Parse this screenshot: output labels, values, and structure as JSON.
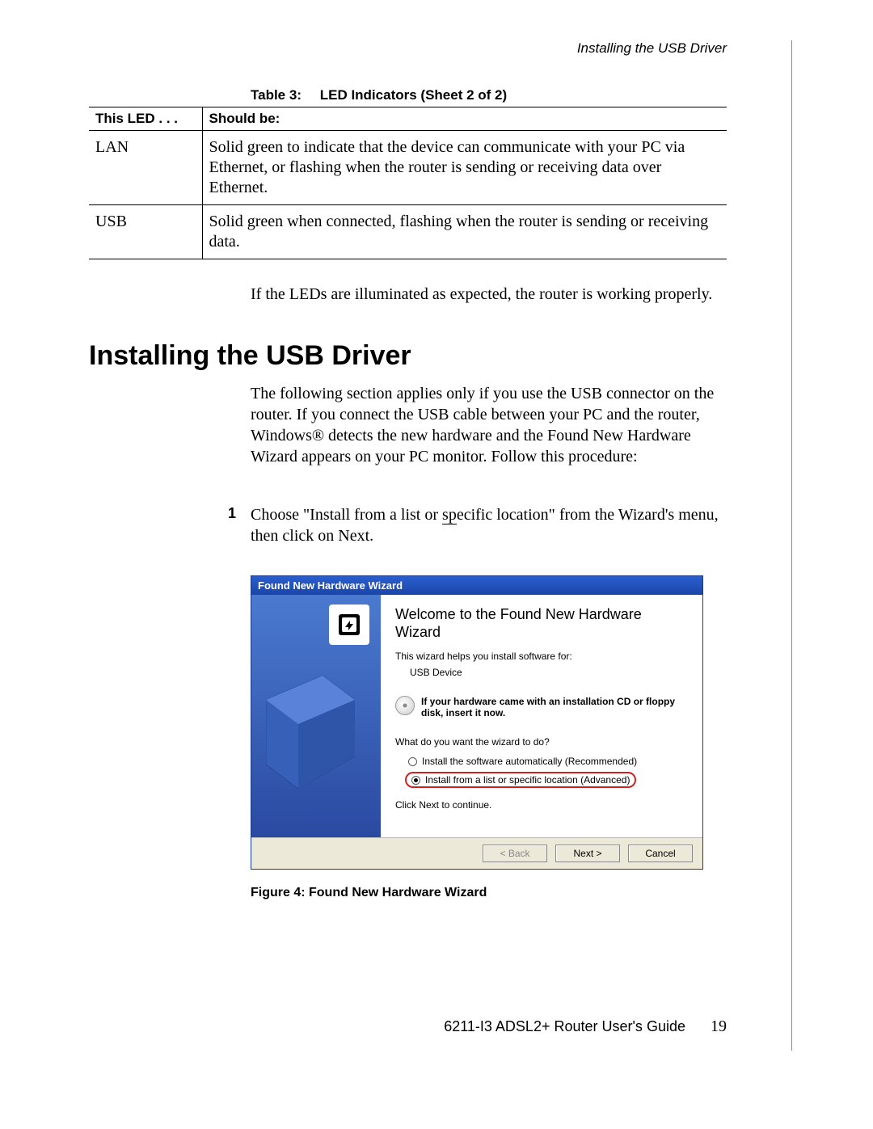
{
  "running_head": "Installing the USB Driver",
  "table": {
    "caption_label": "Table 3:",
    "caption_title": "LED Indicators (Sheet 2 of 2)",
    "head_col1": "This LED . . .",
    "head_col2": "Should be:",
    "rows": [
      {
        "led": "LAN",
        "desc": "Solid green to indicate that the device can communicate with your PC via Ethernet, or flashing when the router is sending or receiving data over Ethernet."
      },
      {
        "led": "USB",
        "desc": "Solid green when connected, flashing when the router is sending or receiving data."
      }
    ]
  },
  "after_table": "If the LEDs are illuminated as expected, the router is working properly.",
  "section_heading": "Installing the USB Driver",
  "section_para": "The following section applies only if you use the USB connector on the router. If you connect the USB cable between your PC and the router, Windows® detects the new hardware and the Found New Hardware Wizard appears on your PC monitor. Follow this procedure:",
  "step1": {
    "num": "1",
    "text_a": "Choose \"Install from a list or ",
    "text_spec": "sp",
    "text_b": "ecific location\" from the Wizard's menu, then click on Next."
  },
  "wizard": {
    "title": "Found New Hardware Wizard",
    "heading": "Welcome to the Found New Hardware Wizard",
    "intro": "This wizard helps you install software for:",
    "device": "USB Device",
    "cd_note": "If your hardware came with an installation CD or floppy disk, insert it now.",
    "question": "What do you want the wizard to do?",
    "opt1": "Install the software automatically (Recommended)",
    "opt2": "Install from a list or specific location (Advanced)",
    "click_next": "Click Next to continue.",
    "btn_back": "< Back",
    "btn_next": "Next >",
    "btn_cancel": "Cancel"
  },
  "figure_caption": "Figure 4: Found New Hardware Wizard",
  "footer_doc": "6211-I3 ADSL2+ Router User's Guide",
  "footer_page": "19"
}
